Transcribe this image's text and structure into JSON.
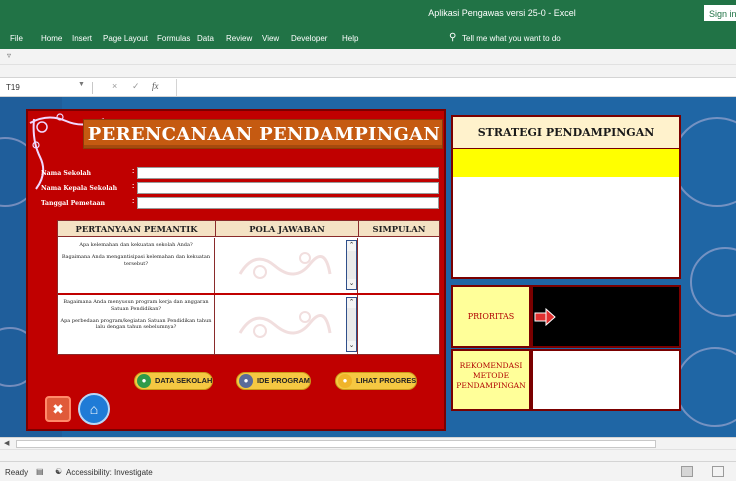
{
  "window": {
    "title": "Aplikasi Pengawas versi 25-0  -  Excel",
    "signin_label": "Sign in"
  },
  "ribbon": {
    "tabs": [
      "File",
      "Home",
      "Insert",
      "Page Layout",
      "Formulas",
      "Data",
      "Review",
      "View",
      "Developer",
      "Help"
    ],
    "tellme": "Tell me what you want to do"
  },
  "formula_bar": {
    "name_box": "T19",
    "cancel": "×",
    "enter": "✓",
    "fx": "fx",
    "value": ""
  },
  "main": {
    "title": "PERENCANAAN PENDAMPINGAN",
    "fields": [
      {
        "label": "Nama Sekolah",
        "colon": ":",
        "value": ""
      },
      {
        "label": "Nama Kepala Sekolah",
        "colon": ":",
        "value": ""
      },
      {
        "label": "Tanggal Pemetaan",
        "colon": ":",
        "value": ""
      }
    ],
    "table": {
      "headers": [
        "PERTANYAAN PEMANTIK",
        "POLA JAWABAN",
        "SIMPULAN"
      ],
      "rows": [
        {
          "questions": [
            "Apa kelemahan dan kekuatan sekolah Anda?",
            "Bagaimana Anda mengantisipasi kelemahan dan kekuatan tersebut?"
          ],
          "answer": "",
          "conclusion": ""
        },
        {
          "questions": [
            "Bagaimana Anda menyusun program kerja dan anggaran Satuan Pendidikan?",
            "Apa perbedaan program/kegiatan Satuan Pendidikan tahun lalu dengan tahun sebelumnya?"
          ],
          "answer": "",
          "conclusion": ""
        }
      ]
    },
    "buttons": {
      "data_sekolah": "DATA SEKOLAH",
      "ide_program": "IDE PROGRAM",
      "lihat_progres": "LIHAT PROGRES"
    }
  },
  "right": {
    "strategi_title": "STRATEGI PENDAMPINGAN",
    "prioritas_label": "PRIORITAS",
    "rekomendasi_label": "REKOMENDASI METODE PENDAMPINGAN"
  },
  "status": {
    "ready": "Ready",
    "accessibility": "Accessibility: Investigate"
  },
  "colors": {
    "excel_green": "#217346",
    "panel_red": "#c00000",
    "header_orange": "#c55a11",
    "sheet_blue": "#1f66a5",
    "highlight_yellow": "#ffff00",
    "button_yellow": "#f5c842"
  },
  "icons": {
    "close": "close-icon",
    "home": "home-icon",
    "arrow": "arrow-right-icon",
    "lightbulb": "lightbulb-icon"
  }
}
